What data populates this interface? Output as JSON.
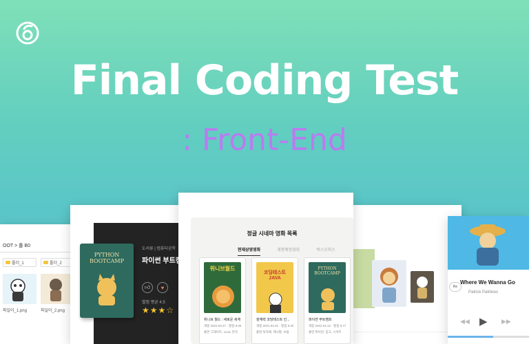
{
  "banner": {
    "title": "Final Coding Test",
    "subtitle": ": Front-End"
  },
  "colors": {
    "accent_purple": "#b97cf0",
    "title_white": "#ffffff",
    "bg_top": "#7fe0b8",
    "bg_bottom": "#56c2c9"
  },
  "explorer": {
    "path": "OOT > 폴 B0",
    "folders": [
      "폴더_1",
      "폴더_2"
    ],
    "files": [
      "파일이_1.png",
      "파일이_2.png"
    ]
  },
  "book_detail": {
    "cover_title": "PYTHON BOOTCAMP",
    "meta": "도서류 | 컴퓨터공학",
    "title": "파이썬 부트캠프",
    "rating_label": "별점 평균 4.5",
    "stars": "★★★☆"
  },
  "movie_list": {
    "heading": "정글 시네마 영화 목록",
    "tabs": [
      "현재상영영화",
      "개봉예정영화",
      "박스오피스"
    ],
    "items": [
      {
        "cover": "위니브월드",
        "name": "위니브 월드 : 새로운 세계",
        "line1": "개봉 2022.03.27 · 평점 9.06",
        "line2": "출연 그레이트, Licat, 뮤직"
      },
      {
        "cover": "코딩테스트 JAVA",
        "name": "잠재력 코딩테스트 인...",
        "line1": "개봉 2021.04.01 · 평점 8.20",
        "line2": "출연 독자배, 캐시별, 보블"
      },
      {
        "cover": "PYTHON BOOTCAMP",
        "name": "파이썬 부트캠프",
        "line1": "개봉 2022.04.12 · 평점 8.77",
        "line2": "출연 파이썬, 장고, 스마트"
      }
    ]
  },
  "music": {
    "song": "Where We Wanna Go",
    "artist": "Patrick Patrikios",
    "progress_fraction": 0.56,
    "pill": "Re"
  }
}
